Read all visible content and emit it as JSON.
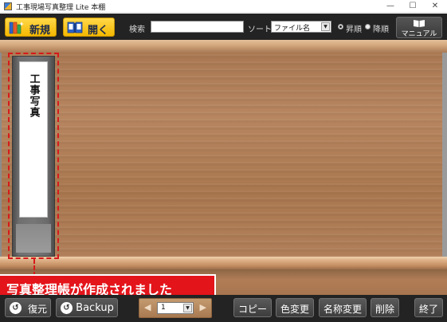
{
  "window": {
    "title": "工事現場写真整理 Lite 本棚",
    "minimize": "—",
    "maximize": "☐",
    "close": "✕"
  },
  "toolbar": {
    "new_label": "新規",
    "open_label": "開く",
    "search_label": "検索",
    "search_value": "",
    "sort_label": "ソート",
    "sort_value": "ファイル名",
    "sort_arrow": "▼",
    "asc_label": "昇順",
    "desc_label": "降順",
    "sort_order_selected": "asc",
    "manual_label": "マニュアル"
  },
  "shelf": {
    "binders": [
      {
        "title": "工事写真",
        "selected": true
      }
    ]
  },
  "notification": {
    "text": "写真整理帳が作成されました"
  },
  "bottombar": {
    "restore_label": "復元",
    "backup_label": "Backup",
    "page_value": "1",
    "page_arrow": "▼",
    "prev": "◀",
    "next": "▶",
    "copy_label": "コピー",
    "color_label": "色変更",
    "rename_label": "名称変更",
    "delete_label": "削除",
    "quit_label": "終了"
  },
  "colors": {
    "toolbar_bg": "#232323",
    "accent_yellow": "#f4b800",
    "notification_red": "#e3141a",
    "selection_dash": "#d61a1a",
    "shelf_wood": "#b07d57"
  }
}
